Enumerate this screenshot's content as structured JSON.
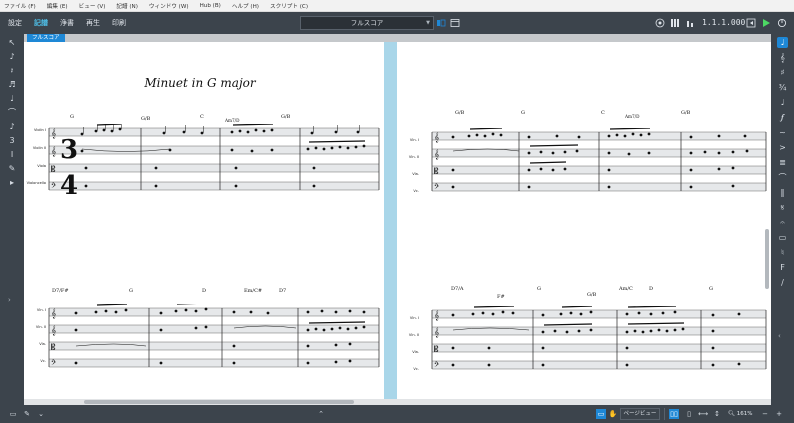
{
  "menu": [
    "ファイル (F)",
    "編集 (E)",
    "ビュー (V)",
    "記譜 (N)",
    "ウィンドウ (W)",
    "Hub (B)",
    "ヘルプ (H)",
    "スクリプト (C)"
  ],
  "toolbar": {
    "modes": [
      {
        "label": "設定",
        "active": false
      },
      {
        "label": "記譜",
        "active": true
      },
      {
        "label": "浄書",
        "active": false
      },
      {
        "label": "再生",
        "active": false
      },
      {
        "label": "印刷",
        "active": false
      }
    ],
    "layout_selector": "フルスコア",
    "position_readout": "1.1.1.000"
  },
  "layout_tab": "フルスコア",
  "score": {
    "title": "Minuet in G major",
    "time_signature_top": "3",
    "time_signature_bottom": "4",
    "instruments_full": [
      "Violin I",
      "Violin II",
      "Viola",
      "Violoncello"
    ],
    "instruments_short": [
      "Vln. I",
      "Vln. II",
      "Vla.",
      "Vc."
    ],
    "systems": [
      {
        "chords": [
          "G",
          "G/B",
          "C",
          "Bm7",
          "G/B"
        ],
        "subchords": [
          "",
          "",
          "",
          "Am7/D",
          ""
        ]
      },
      {
        "chords": [
          "D7/F#",
          "G",
          "D",
          "Em/C#",
          "D7"
        ],
        "subchords": [
          "",
          "",
          "",
          "",
          ""
        ]
      },
      {
        "chords": [
          "G/B",
          "G",
          "C",
          "Am7/D",
          "G/B"
        ],
        "subchords": [
          "",
          "",
          "",
          "",
          ""
        ]
      },
      {
        "chords": [
          "D7/A",
          "F#",
          "G",
          "G/B",
          "Am/C",
          "D",
          "G"
        ],
        "subchords": []
      }
    ]
  },
  "statusbar": {
    "view_type": "ページビュー",
    "zoom": "161%"
  },
  "colors": {
    "accent": "#4fc1ea",
    "selection_blue": "#1e88d6",
    "chrome": "#3c444c",
    "page_divider": "#a9d6e9"
  },
  "icons": {
    "left_tools": [
      "pointer-icon",
      "note-input-icon",
      "rest-icon",
      "chord-icon",
      "lock-icon",
      "slur-icon",
      "grace-note-icon",
      "tuplet-icon",
      "insert-icon",
      "pen-icon",
      "select-icon"
    ],
    "right_panels": [
      "notes-panel-icon",
      "clefs-icon",
      "key-signature-icon",
      "time-signature-icon",
      "tempo-icon",
      "dynamics-icon",
      "ornaments-icon",
      "articulations-icon",
      "arpeggio-icon",
      "playing-techniques-icon",
      "barlines-icon",
      "repeat-icon",
      "holds-icon",
      "lyrics-icon",
      "chord-symbols-icon",
      "fingering-icon",
      "lines-icon"
    ]
  }
}
